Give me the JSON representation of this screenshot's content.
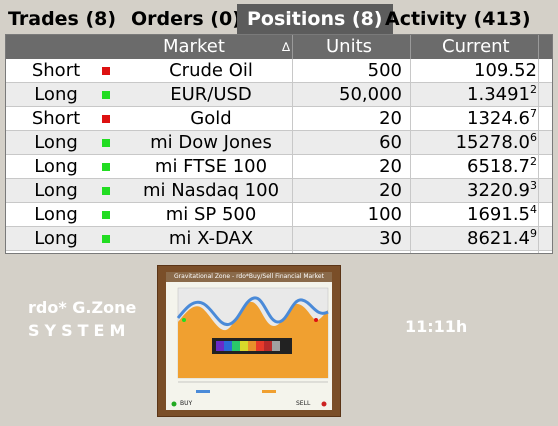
{
  "tabs": [
    {
      "label": "Trades (8)",
      "active": false
    },
    {
      "label": "Orders (0)",
      "active": false
    },
    {
      "label": "Positions (8)",
      "active": true
    },
    {
      "label": "Activity (413)",
      "active": false
    }
  ],
  "table": {
    "headers": {
      "market": "Market",
      "sort_indicator": "∆",
      "units": "Units",
      "current": "Current"
    },
    "rows": [
      {
        "side": "Short",
        "status": "red",
        "market": "Crude Oil",
        "units": "500",
        "current": "109.52",
        "sup": ""
      },
      {
        "side": "Long",
        "status": "green",
        "market": "EUR/USD",
        "units": "50,000",
        "current": "1.3491",
        "sup": "2"
      },
      {
        "side": "Short",
        "status": "red",
        "market": "Gold",
        "units": "20",
        "current": "1324.6",
        "sup": "7"
      },
      {
        "side": "Long",
        "status": "green",
        "market": "mi Dow Jones",
        "units": "60",
        "current": "15278.0",
        "sup": "6"
      },
      {
        "side": "Long",
        "status": "green",
        "market": "mi FTSE 100",
        "units": "20",
        "current": "6518.7",
        "sup": "2"
      },
      {
        "side": "Long",
        "status": "green",
        "market": "mi Nasdaq 100",
        "units": "20",
        "current": "3220.9",
        "sup": "3"
      },
      {
        "side": "Long",
        "status": "green",
        "market": "mi SP 500",
        "units": "100",
        "current": "1691.5",
        "sup": "4"
      },
      {
        "side": "Long",
        "status": "green",
        "market": "mi X-DAX",
        "units": "30",
        "current": "8621.4",
        "sup": "9"
      }
    ]
  },
  "brand": {
    "line1": "rdo* G.Zone",
    "line2": "SYSTEM"
  },
  "clock": "11:11h",
  "thumbnail": {
    "title": "Gravitational Zone - rdo*Buy/Sell Financial Market",
    "buy_label": "BUY",
    "sell_label": "SELL"
  },
  "colors": {
    "green": "#22dd22",
    "red": "#dd1111",
    "header_bg": "#6b6b6b",
    "active_tab_bg": "#5c5c5c"
  }
}
